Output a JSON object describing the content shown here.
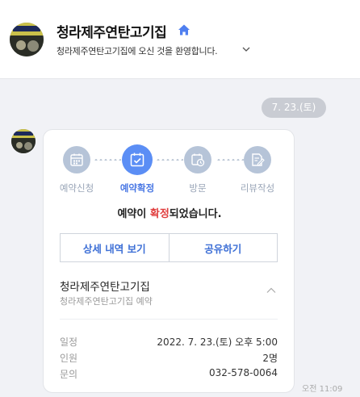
{
  "header": {
    "title": "청라제주연탄고기집",
    "subtitle": "청라제주연탄고기집에 오신 것을 환영합니다."
  },
  "chat": {
    "date_label": "7. 23.(토)",
    "timestamp": "오전 11:09"
  },
  "card": {
    "steps": [
      {
        "label": "예약신청",
        "icon": "calendar-grid-icon"
      },
      {
        "label": "예약확정",
        "icon": "calendar-check-icon"
      },
      {
        "label": "방문",
        "icon": "calendar-clock-icon"
      },
      {
        "label": "리뷰작성",
        "icon": "pencil-note-icon"
      }
    ],
    "confirm": {
      "pre": "예약이 ",
      "highlight": "확정",
      "post": "되었습니다."
    },
    "buttons": {
      "detail": "상세 내역 보기",
      "share": "공유하기"
    },
    "shop_name": "청라제주연탄고기집",
    "shop_sub": "청라제주연탄고기집 예약",
    "info": [
      {
        "key": "일정",
        "value": "2022. 7. 23.(토) 오후 5:00"
      },
      {
        "key": "인원",
        "value": "2명"
      },
      {
        "key": "문의",
        "value": "032-578-0064"
      }
    ]
  },
  "colors": {
    "accent": "#5b8ef5",
    "highlight": "#e03e3e",
    "step_inactive": "#b6c4d8"
  }
}
